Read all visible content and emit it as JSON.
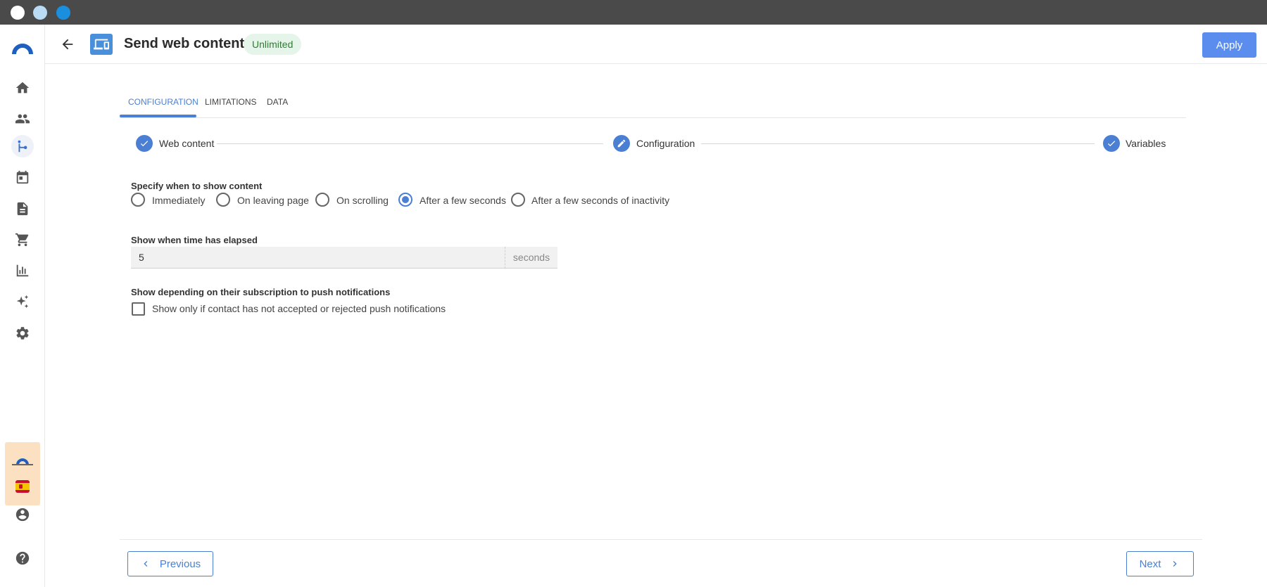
{
  "header": {
    "title": "Send web content",
    "badge": "Unlimited",
    "apply_label": "Apply"
  },
  "sidebar": {
    "items": [
      {
        "name": "home-icon",
        "active": false
      },
      {
        "name": "contacts-icon",
        "active": false
      },
      {
        "name": "workflow-icon",
        "active": true
      },
      {
        "name": "calendar-icon",
        "active": false
      },
      {
        "name": "document-icon",
        "active": false
      },
      {
        "name": "cart-icon",
        "active": false
      },
      {
        "name": "chart-icon",
        "active": false
      },
      {
        "name": "sparkle-icon",
        "active": false
      },
      {
        "name": "gear-icon",
        "active": false
      }
    ]
  },
  "tabs": [
    {
      "label": "CONFIGURATION",
      "active": true
    },
    {
      "label": "LIMITATIONS",
      "active": false
    },
    {
      "label": "DATA",
      "active": false
    }
  ],
  "stepper": {
    "steps": [
      {
        "label": "Web content",
        "state": "done"
      },
      {
        "label": "Configuration",
        "state": "editing"
      },
      {
        "label": "Variables",
        "state": "done"
      }
    ]
  },
  "show_content": {
    "label": "Specify when to show content",
    "options": [
      "Immediately",
      "On leaving page",
      "On scrolling",
      "After a few seconds",
      "After a few seconds of inactivity"
    ],
    "selected": "After a few seconds"
  },
  "elapsed": {
    "label": "Show when time has elapsed",
    "value": "5",
    "unit": "seconds"
  },
  "subscription": {
    "label": "Show depending on their subscription to push notifications",
    "checkbox_label": "Show only if contact has not accepted or rejected push notifications",
    "checked": false
  },
  "footer": {
    "previous_label": "Previous",
    "next_label": "Next"
  },
  "colors": {
    "accent": "#4a7fd4",
    "apply_bg": "#5b8def",
    "badge_bg": "#e6f5e9",
    "badge_text": "#2e7d32"
  }
}
